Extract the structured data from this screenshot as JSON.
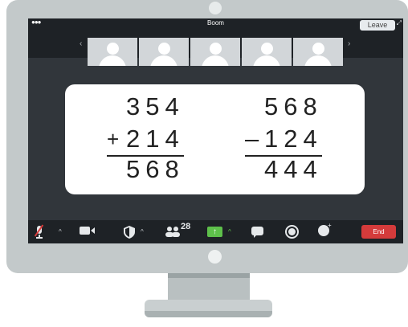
{
  "window": {
    "title": "Boom",
    "menu_dots": "●●●",
    "leave_label": "Leave",
    "expand_glyph": "⤢"
  },
  "participants": {
    "count_label": "28"
  },
  "thumbnails": [
    {
      "name": "participant-1"
    },
    {
      "name": "participant-2"
    },
    {
      "name": "participant-3"
    },
    {
      "name": "participant-4"
    },
    {
      "name": "participant-5"
    }
  ],
  "strip_nav": {
    "prev": "‹",
    "next": "›"
  },
  "board": {
    "left_problem": {
      "top": "354",
      "bottom": "214",
      "operator": "+",
      "result": "568"
    },
    "right_problem": {
      "top": "568",
      "bottom": "124",
      "operator": "–",
      "result": "444"
    }
  },
  "toolbar": {
    "end_label": "End",
    "icons": [
      "microphone-muted-icon",
      "video-camera-icon",
      "security-shield-icon",
      "participants-icon",
      "share-screen-icon",
      "chat-icon",
      "record-icon",
      "reactions-icon"
    ],
    "caret": "^"
  },
  "colors": {
    "end_button": "#d43b3b",
    "share_button": "#5ec04b",
    "screen_bg": "#31363b",
    "bar_bg": "#1e2226"
  }
}
